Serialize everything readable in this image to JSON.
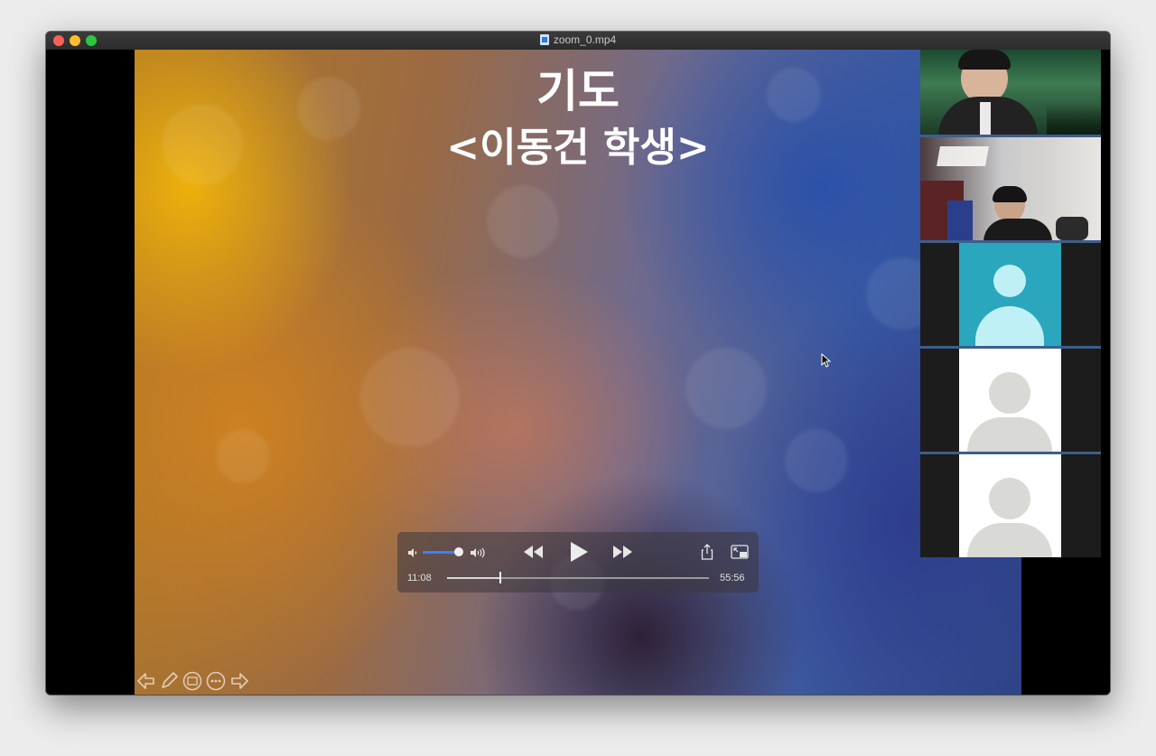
{
  "window": {
    "title": "zoom_0.mp4"
  },
  "slide": {
    "title": "기도",
    "subtitle": "<이동건 학생>"
  },
  "player": {
    "elapsed": "11:08",
    "remaining": "55:56",
    "progress": 0.2,
    "volume": 0.9,
    "icons": {
      "volume_low": "speaker-low-icon",
      "volume_high": "speaker-high-icon",
      "rewind": "rewind-icon",
      "play": "play-icon",
      "fast_forward": "fast-forward-icon",
      "share": "share-icon",
      "picture_in_picture": "picture-in-picture-icon"
    }
  },
  "gallery": {
    "tiles": [
      {
        "kind": "video"
      },
      {
        "kind": "video"
      },
      {
        "kind": "avatar",
        "color": "#2aa7bd"
      },
      {
        "kind": "avatar",
        "color": "#ffffff"
      },
      {
        "kind": "avatar",
        "color": "#ffffff"
      }
    ]
  },
  "annotation_toolbar": {
    "icons": [
      "arrow-left-icon",
      "pen-icon",
      "slides-icon",
      "more-icon",
      "arrow-right-icon"
    ]
  },
  "colors": {
    "accent": "#3b82f6",
    "tile_border": "#3c5f8c"
  }
}
